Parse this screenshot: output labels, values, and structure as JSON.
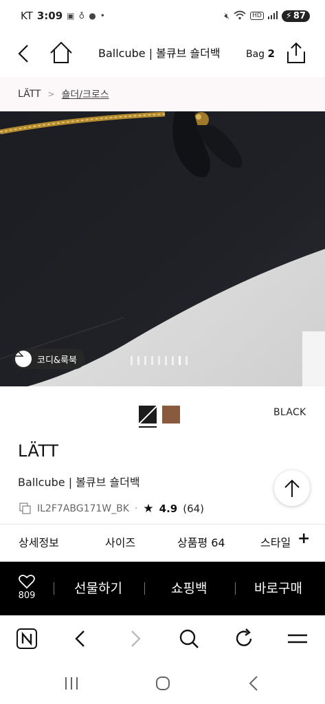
{
  "status_bar": {
    "carrier": "KT",
    "time": "3:09",
    "battery": "87"
  },
  "header": {
    "title": "Ballcube | 볼큐브 숄더백",
    "bag_label": "Bag",
    "bag_count": "2"
  },
  "breadcrumb": {
    "brand": "LÄTT",
    "category": "숄더/크로스"
  },
  "gallery": {
    "codi_button_label": "코디&룩북",
    "page_count": 9,
    "active_page": 8
  },
  "colors": {
    "selected_name": "BLACK",
    "swatches": [
      {
        "name": "black",
        "hex": "#1c1c1c"
      },
      {
        "name": "brown",
        "hex": "#8a5a3e"
      }
    ]
  },
  "product": {
    "brand": "LÄTT",
    "name": "Ballcube | 볼큐브 숄더백",
    "code": "IL2F7ABG171W_BK",
    "rating": "4.9",
    "review_count": "(64)"
  },
  "tabs": [
    {
      "label": "상세정보"
    },
    {
      "label": "사이즈"
    },
    {
      "label": "상품평 64"
    },
    {
      "label": "스타일"
    }
  ],
  "actions": {
    "wish_count": "809",
    "gift": "선물하기",
    "cart": "쇼핑백",
    "buy": "바로구매"
  },
  "icons": {
    "back": "chevron-left-icon",
    "home": "home-icon",
    "share": "share-icon",
    "scroll_top": "arrow-up-icon",
    "heart": "heart-icon",
    "naver": "naver-n-icon",
    "search": "search-icon",
    "refresh": "refresh-icon",
    "menu": "menu-icon"
  }
}
